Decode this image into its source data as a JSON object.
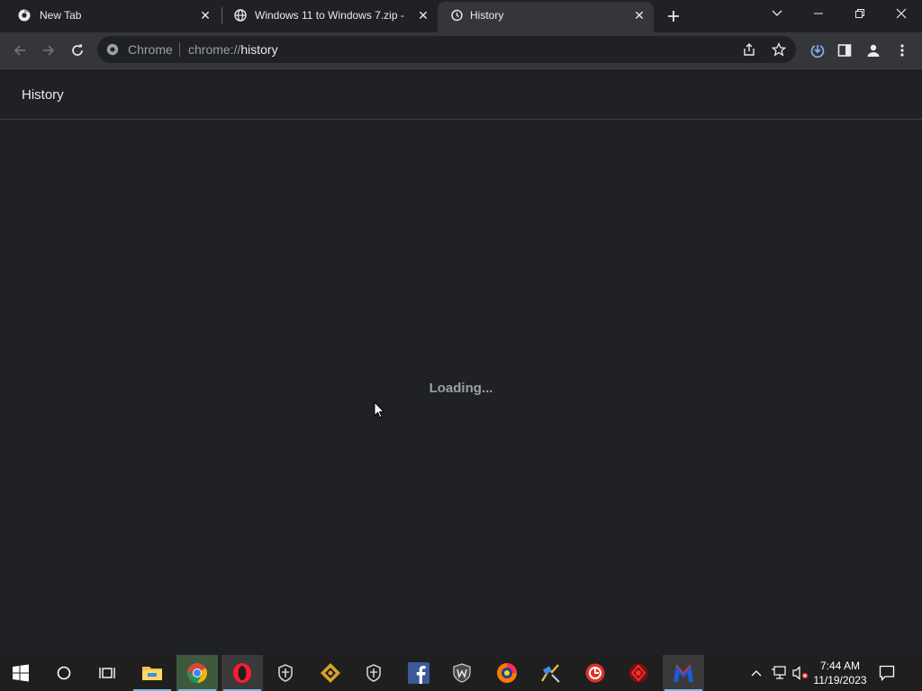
{
  "tabs": [
    {
      "title": "New Tab",
      "icon": "chrome-icon",
      "active": false
    },
    {
      "title": "Windows 11 to Windows 7.zip -",
      "icon": "globe-icon",
      "active": false
    },
    {
      "title": "History",
      "icon": "history-icon",
      "active": true
    }
  ],
  "omnibox": {
    "chip": "Chrome",
    "url_prefix": "chrome://",
    "url_path": "history"
  },
  "page": {
    "title": "History",
    "loading_text": "Loading..."
  },
  "taskbar": {
    "pinned": [
      "windows-start-icon",
      "cortana-icon",
      "task-view-icon",
      "file-explorer-icon",
      "chrome-icon",
      "opera-icon",
      "world-of-warships-icon",
      "game-app-icon",
      "world-of-warships-icon-2",
      "facebook-icon",
      "world-of-tanks-icon",
      "game-center-icon",
      "app-icon",
      "app-red-icon",
      "app-dark-icon",
      "malwarebytes-icon"
    ],
    "clock_time": "7:44 AM",
    "clock_date": "11/19/2023"
  },
  "colors": {
    "background": "#202124",
    "toolbar": "#35363a",
    "text": "#e8eaed",
    "muted": "#9aa0a6"
  }
}
